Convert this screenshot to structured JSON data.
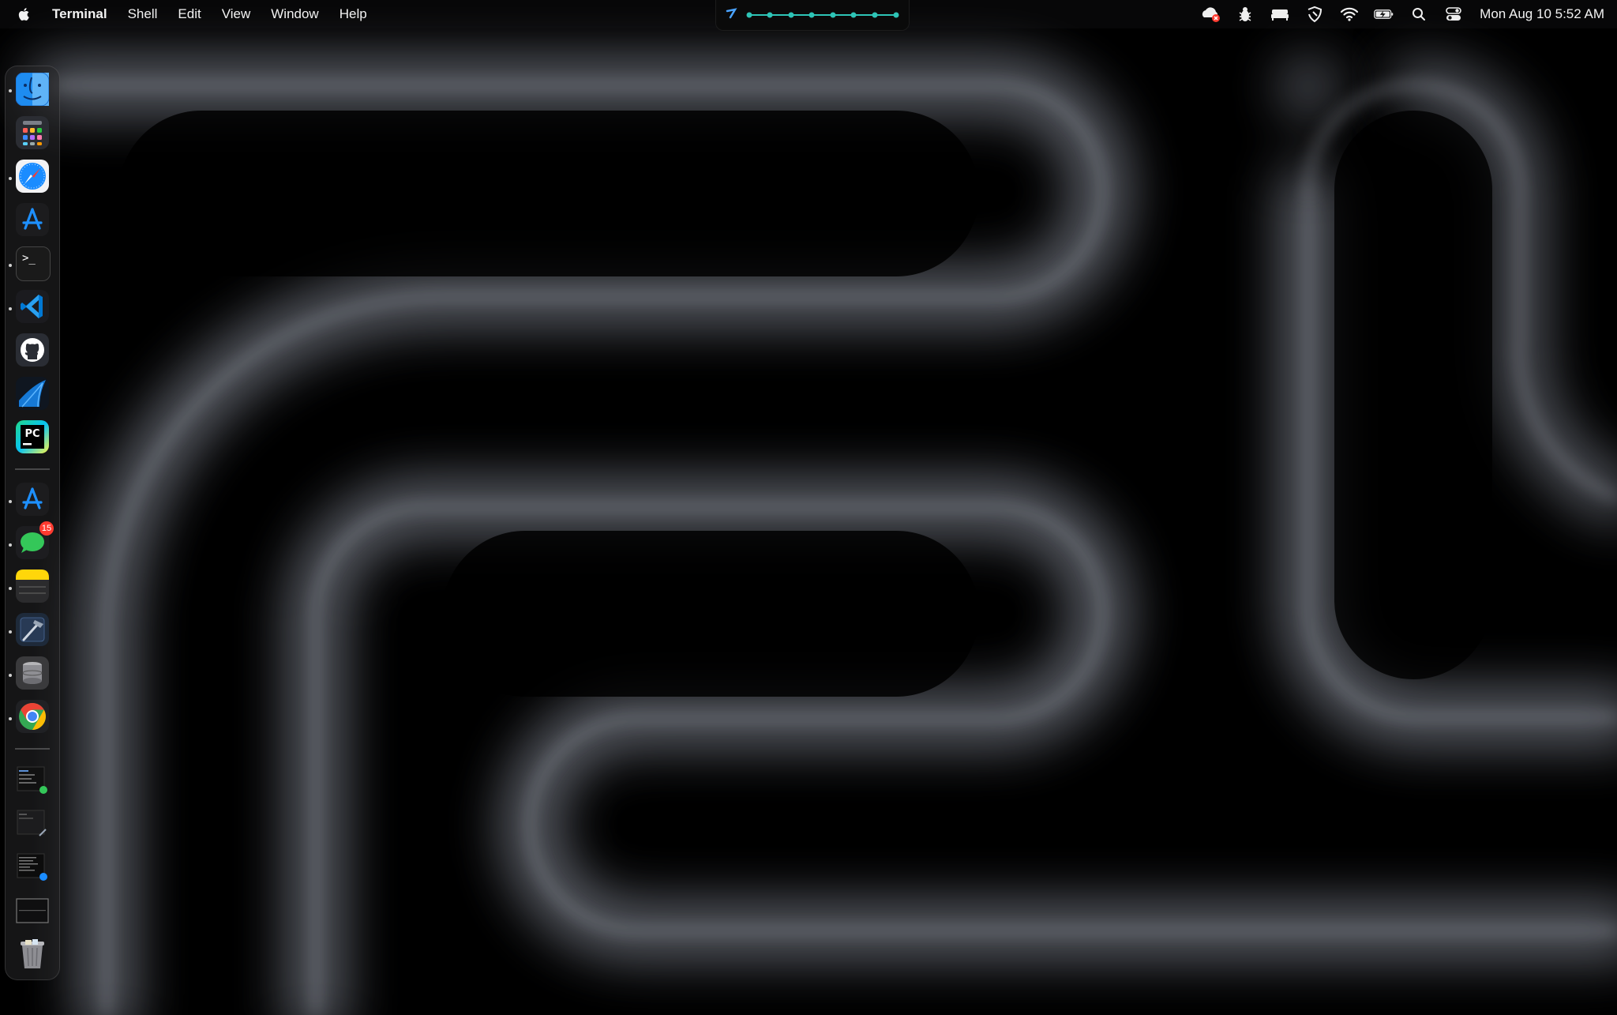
{
  "menubar": {
    "app_name": "Terminal",
    "menus": [
      "Shell",
      "Edit",
      "View",
      "Window",
      "Help"
    ],
    "clock": "Mon Aug 10  5:52 AM",
    "status_icons": [
      "cloud-alert-icon",
      "bug-icon",
      "bed-icon",
      "shield-icon",
      "wifi-icon",
      "battery-charging-icon",
      "search-icon",
      "control-center-icon"
    ]
  },
  "center_widget": {
    "icon": "speed-test-icon",
    "indicator": "timeline-dots"
  },
  "dock": {
    "items": [
      {
        "name": "finder",
        "icon": "finder-icon",
        "running": true
      },
      {
        "name": "launchpad",
        "icon": "launchpad-icon",
        "running": false
      },
      {
        "name": "safari",
        "icon": "safari-icon",
        "running": true
      },
      {
        "name": "app-store",
        "icon": "app-store-icon",
        "running": false
      },
      {
        "name": "terminal",
        "icon": "terminal-icon",
        "running": true,
        "label": ">_"
      },
      {
        "name": "vscode",
        "icon": "vscode-icon",
        "running": true
      },
      {
        "name": "github-desktop",
        "icon": "github-icon",
        "running": false
      },
      {
        "name": "wireshark",
        "icon": "wireshark-icon",
        "running": false
      },
      {
        "name": "pycharm",
        "icon": "pycharm-icon",
        "running": false,
        "label": "PC"
      },
      {
        "name": "app-store-2",
        "icon": "app-store-icon",
        "running": true
      },
      {
        "name": "messages",
        "icon": "messages-icon",
        "running": true,
        "badge": "15"
      },
      {
        "name": "notes",
        "icon": "notes-icon",
        "running": true
      },
      {
        "name": "xcode",
        "icon": "xcode-icon",
        "running": true
      },
      {
        "name": "disk-utility",
        "icon": "disk-utility-icon",
        "running": true
      },
      {
        "name": "chrome",
        "icon": "chrome-icon",
        "running": true
      },
      {
        "name": "minimized-window-1",
        "icon": "window-thumbnail-icon",
        "running": false
      },
      {
        "name": "minimized-window-2",
        "icon": "window-thumbnail-icon",
        "running": false
      },
      {
        "name": "minimized-window-3",
        "icon": "window-thumbnail-icon",
        "running": false
      },
      {
        "name": "minimized-window-4",
        "icon": "window-thumbnail-icon",
        "running": false
      },
      {
        "name": "trash",
        "icon": "trash-icon",
        "running": false
      }
    ]
  },
  "colors": {
    "background": "#000000",
    "accent_teal": "#2ec4b6",
    "badge_red": "#ff3b30"
  }
}
